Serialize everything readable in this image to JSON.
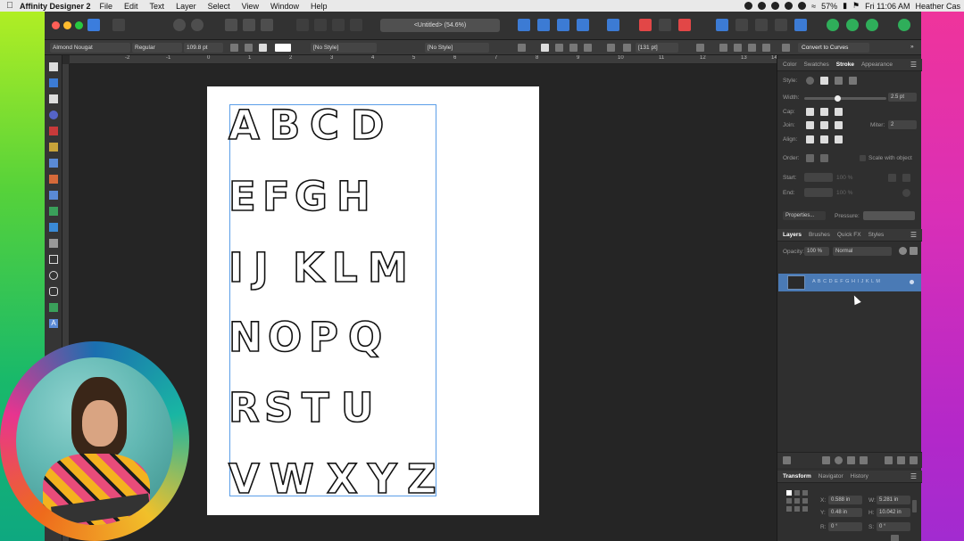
{
  "menubar": {
    "app_name": "Affinity Designer 2",
    "items": [
      "File",
      "Edit",
      "Text",
      "Layer",
      "Select",
      "View",
      "Window",
      "Help"
    ],
    "battery": "57%",
    "clock": "Fri 11:06 AM",
    "user": "Heather Cas"
  },
  "toolbar": {
    "doc_title": "<Untitled> (54.6%)"
  },
  "context": {
    "font": "Almond Nougat",
    "weight": "Regular",
    "size": "109.8 pt",
    "char_style": "[No Style]",
    "para_style": "[No Style]",
    "leading": "[131 pt]",
    "convert": "Convert to Curves"
  },
  "ruler": {
    "ticks": [
      "-2",
      "-1",
      "0",
      "1",
      "2",
      "3",
      "4",
      "5",
      "6",
      "7",
      "8",
      "9",
      "10",
      "11",
      "12",
      "13",
      "14"
    ]
  },
  "canvas": {
    "rows": [
      [
        "A",
        "B",
        "C",
        "D"
      ],
      [
        "E",
        "F",
        "G",
        "H"
      ],
      [
        "I",
        "J",
        "K",
        "L",
        "M"
      ],
      [
        "N",
        "O",
        "P",
        "Q"
      ],
      [
        "R",
        "S",
        "T",
        "U"
      ],
      [
        "V",
        "W",
        "X",
        "Y",
        "Z"
      ]
    ]
  },
  "stroke_panel": {
    "tabs": [
      "Color",
      "Swatches",
      "Stroke",
      "Appearance"
    ],
    "active_tab": "Stroke",
    "style_label": "Style:",
    "width_label": "Width:",
    "width_value": "2.5 pt",
    "width_fraction": 0.4,
    "cap_label": "Cap:",
    "join_label": "Join:",
    "miter_label": "Miter:",
    "miter_value": "2",
    "align_label": "Align:",
    "order_label": "Order:",
    "scale_label": "Scale with object",
    "start_label": "Start:",
    "end_label": "End:",
    "start_pct": "100 %",
    "end_pct": "100 %",
    "properties": "Properties...",
    "pressure_label": "Pressure:"
  },
  "layers_panel": {
    "tabs": [
      "Layers",
      "Brushes",
      "Quick FX",
      "Styles"
    ],
    "active_tab": "Layers",
    "opacity_label": "Opacity:",
    "opacity_value": "100 %",
    "blend_mode": "Normal",
    "layer_name": "A B C D E F G H I J K L M"
  },
  "transform_panel": {
    "tabs": [
      "Transform",
      "Navigator",
      "History"
    ],
    "active_tab": "Transform",
    "x_label": "X:",
    "x_value": "0.588 in",
    "y_label": "Y:",
    "y_value": "0.48 in",
    "w_label": "W:",
    "w_value": "5.281 in",
    "h_label": "H:",
    "h_value": "10.042 in",
    "r_label": "R:",
    "r_value": "0 °",
    "s_label": "S:",
    "s_value": "0 °"
  },
  "colors": {
    "accent": "#4a7ab5",
    "selection": "#5b9ee8"
  }
}
